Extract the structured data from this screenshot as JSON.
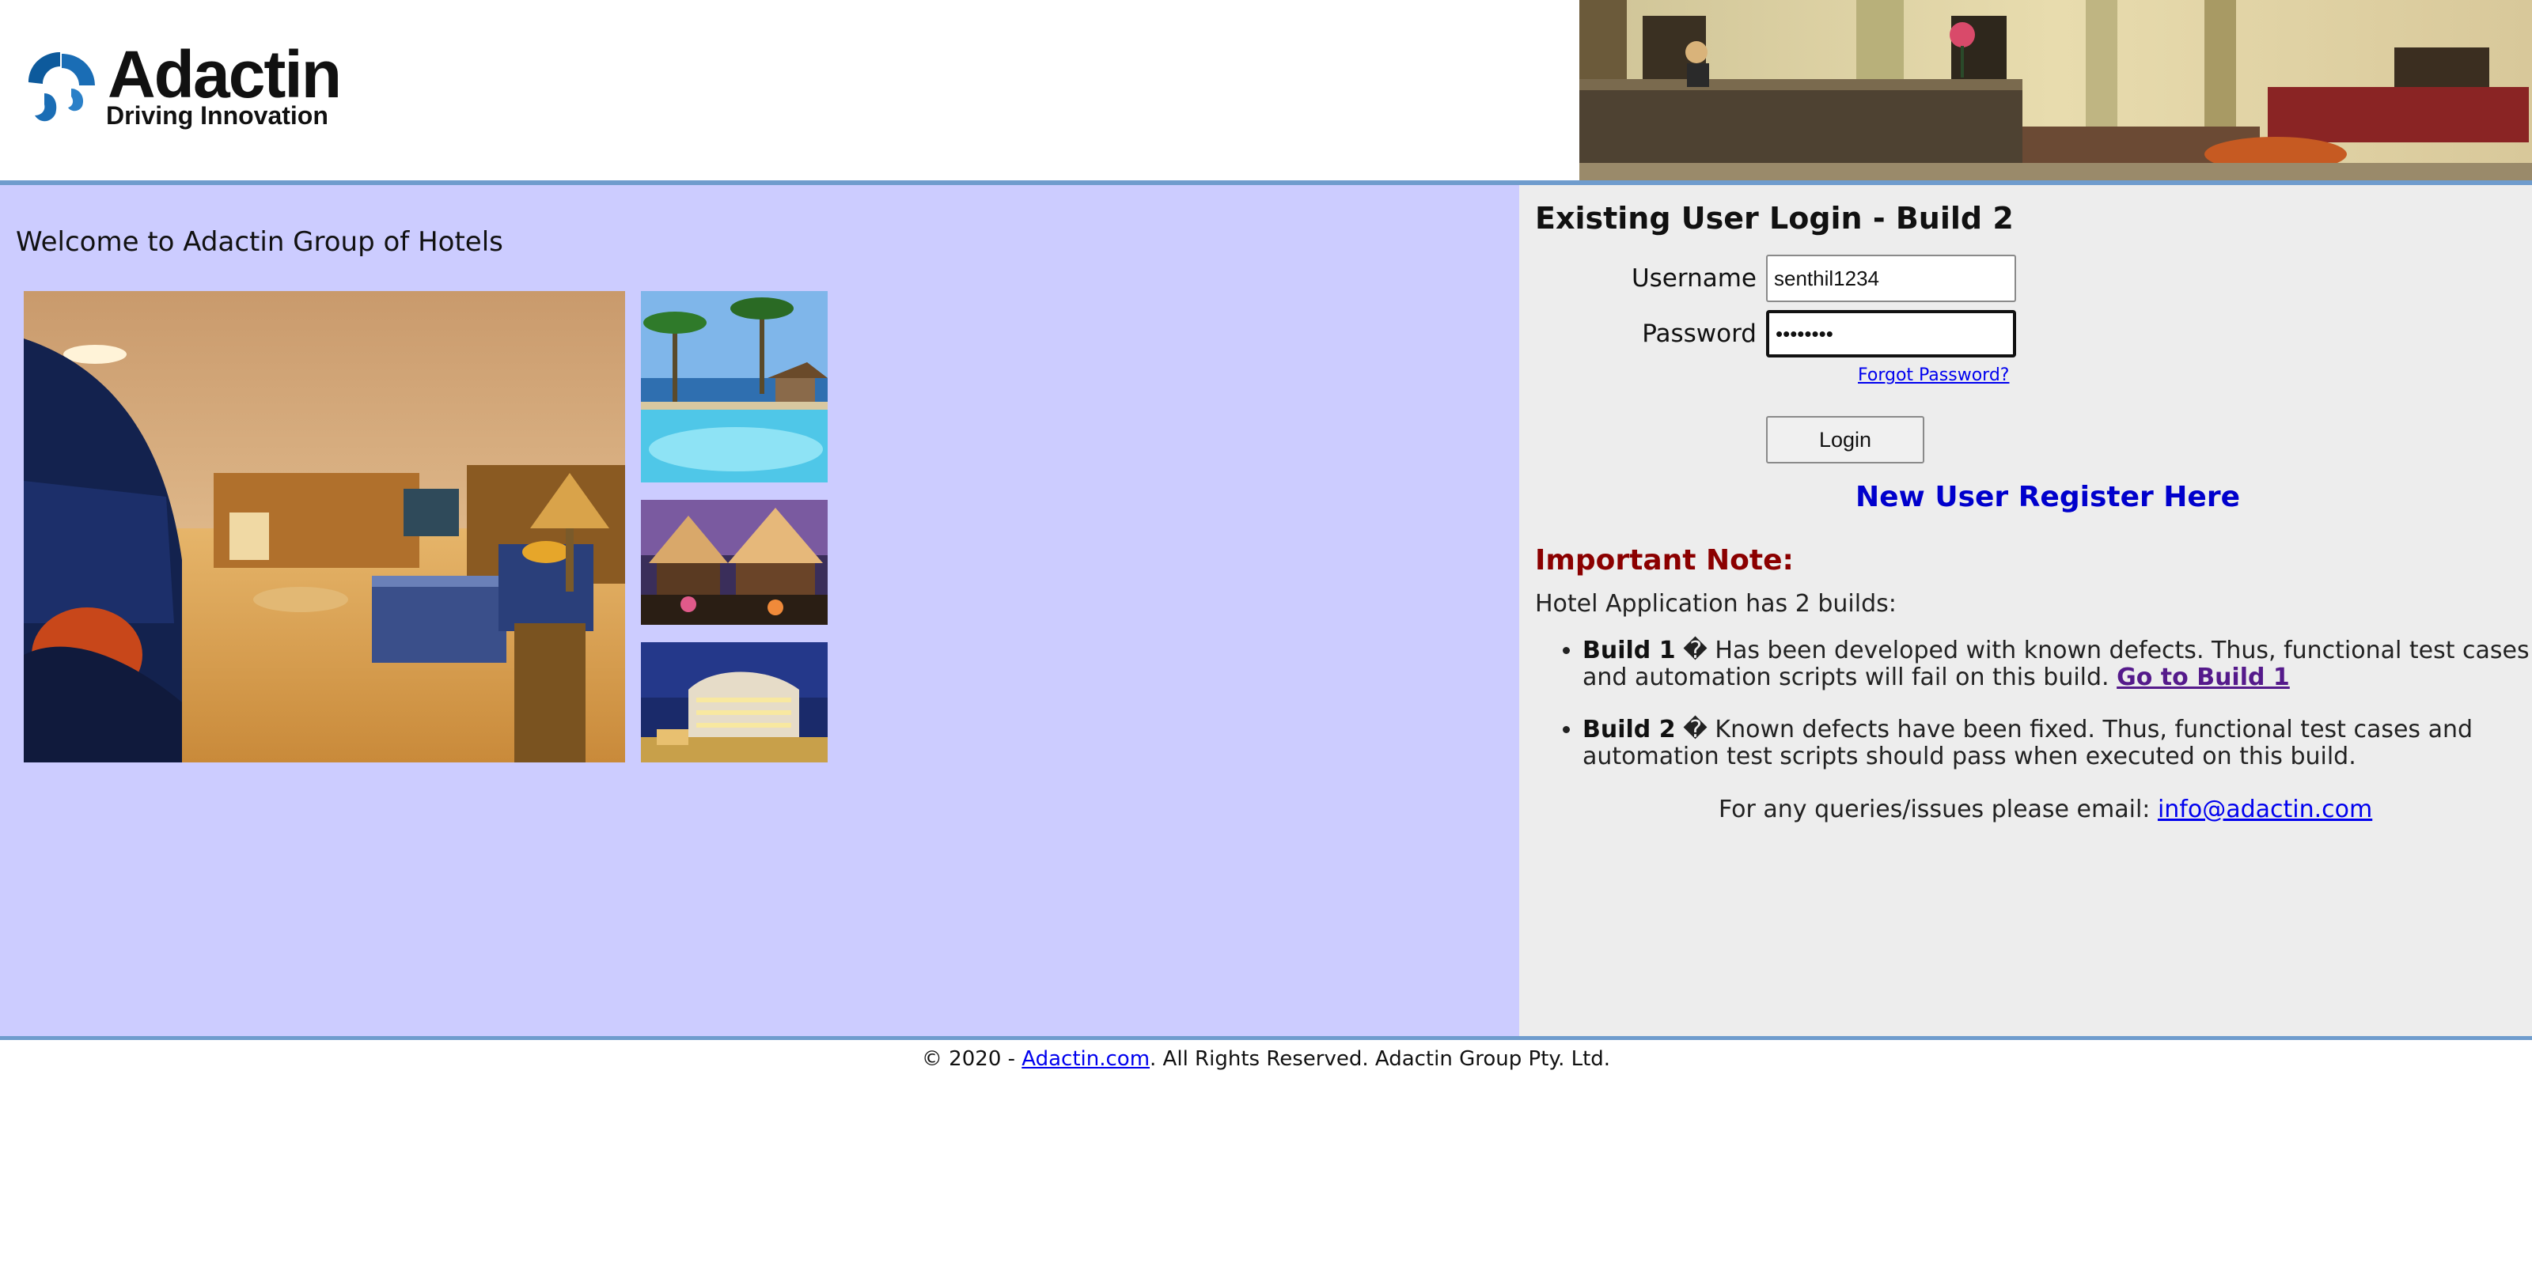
{
  "header": {
    "logo_title": "Adactin",
    "logo_subtitle": "Driving Innovation"
  },
  "left": {
    "welcome": "Welcome to Adactin Group of Hotels"
  },
  "login": {
    "title": "Existing User Login - Build 2",
    "username_label": "Username",
    "username_value": "senthil1234",
    "password_label": "Password",
    "password_value": "••••••••",
    "forgot_link": "Forgot Password?",
    "login_button": "Login",
    "register_link": "New User Register Here"
  },
  "note": {
    "heading": "Important Note:",
    "intro": "Hotel Application has 2 builds:",
    "build1_name": "Build 1",
    "build1_text": " � Has been developed with known defects. Thus, functional test cases and automation scripts will fail on this build. ",
    "build1_link": "Go to Build 1",
    "build2_name": "Build 2",
    "build2_text": " � Known defects have been fixed. Thus, functional test cases and automation test scripts should pass when executed on this build.",
    "contact_text": "For any queries/issues please email: ",
    "contact_email": "info@adactin.com"
  },
  "footer": {
    "prefix": "© 2020 - ",
    "link": "Adactin.com",
    "suffix": ". All Rights Reserved. Adactin Group Pty. Ltd."
  },
  "colors": {
    "left_panel_bg": "#ccccff",
    "right_panel_bg": "#ededed",
    "accent_rule": "#6f9ccd",
    "note_heading": "#8b0000",
    "register_link": "#0000cc"
  },
  "icons": [
    "adactin-logo-icon"
  ]
}
